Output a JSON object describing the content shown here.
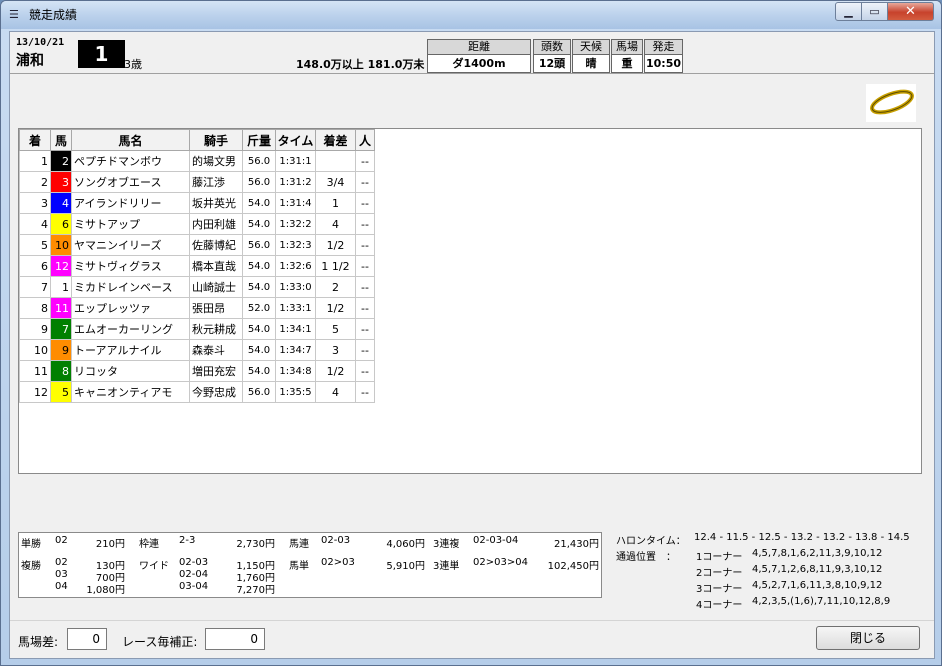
{
  "window": {
    "title": "競走成績",
    "icon": "list-icon"
  },
  "race": {
    "date": "13/10/21",
    "track": "浦和",
    "race_no": "1",
    "class": "3歳",
    "prize": "148.0万以上 181.0万未",
    "info_headers": [
      "距離",
      "頭数",
      "天候",
      "馬場",
      "発走"
    ],
    "info_values": [
      "ダ1400m",
      "12頭",
      "晴",
      "重",
      "10:50"
    ]
  },
  "colors": {
    "post_colors": [
      "#000000",
      "#ff0000",
      "#0000ff",
      "#ffff00",
      "#ff8c00",
      "#ff00ff",
      "#ffffff",
      "#ff00ff",
      "#008000",
      "#ff8c00",
      "#008000",
      "#ffff00"
    ],
    "post_text": [
      "#ffffff",
      "#ffffff",
      "#ffffff",
      "#000000",
      "#000000",
      "#ffffff",
      "#000000",
      "#ffffff",
      "#ffffff",
      "#000000",
      "#ffffff",
      "#000000"
    ]
  },
  "results": {
    "headers": [
      "着",
      "馬",
      "馬名",
      "騎手",
      "斤量",
      "タイム",
      "着差",
      "人"
    ],
    "rows": [
      {
        "pos": "1",
        "no": "2",
        "name": "ペプチドマンボウ",
        "jockey": "的場文男",
        "wt": "56.0",
        "time": "1:31:1",
        "margin": "",
        "pop": "--"
      },
      {
        "pos": "2",
        "no": "3",
        "name": "ソングオブエース",
        "jockey": "藤江渉",
        "wt": "56.0",
        "time": "1:31:2",
        "margin": "3/4",
        "pop": "--"
      },
      {
        "pos": "3",
        "no": "4",
        "name": "アイランドリリー",
        "jockey": "坂井英光",
        "wt": "54.0",
        "time": "1:31:4",
        "margin": "1",
        "pop": "--"
      },
      {
        "pos": "4",
        "no": "6",
        "name": "ミサトアップ",
        "jockey": "内田利雄",
        "wt": "54.0",
        "time": "1:32:2",
        "margin": "4",
        "pop": "--"
      },
      {
        "pos": "5",
        "no": "10",
        "name": "ヤマニンイリーズ",
        "jockey": "佐藤博紀",
        "wt": "56.0",
        "time": "1:32:3",
        "margin": "1/2",
        "pop": "--"
      },
      {
        "pos": "6",
        "no": "12",
        "name": "ミサトヴィグラス",
        "jockey": "橋本直哉",
        "wt": "54.0",
        "time": "1:32:6",
        "margin": "1 1/2",
        "pop": "--"
      },
      {
        "pos": "7",
        "no": "1",
        "name": "ミカドレインベース",
        "jockey": "山崎誠士",
        "wt": "54.0",
        "time": "1:33:0",
        "margin": "2",
        "pop": "--"
      },
      {
        "pos": "8",
        "no": "11",
        "name": "エップレッツァ",
        "jockey": "張田昂",
        "wt": "52.0",
        "time": "1:33:1",
        "margin": "1/2",
        "pop": "--"
      },
      {
        "pos": "9",
        "no": "7",
        "name": "エムオーカーリング",
        "jockey": "秋元耕成",
        "wt": "54.0",
        "time": "1:34:1",
        "margin": "5",
        "pop": "--"
      },
      {
        "pos": "10",
        "no": "9",
        "name": "トーアアルナイル",
        "jockey": "森泰斗",
        "wt": "54.0",
        "time": "1:34:7",
        "margin": "3",
        "pop": "--"
      },
      {
        "pos": "11",
        "no": "8",
        "name": "リコッタ",
        "jockey": "増田充宏",
        "wt": "54.0",
        "time": "1:34:8",
        "margin": "1/2",
        "pop": "--"
      },
      {
        "pos": "12",
        "no": "5",
        "name": "キャニオンティアモ",
        "jockey": "今野忠成",
        "wt": "56.0",
        "time": "1:35:5",
        "margin": "4",
        "pop": "--"
      }
    ]
  },
  "payouts": {
    "win": {
      "label": "単勝",
      "combo": "02",
      "amount": "210円"
    },
    "waku": {
      "label": "枠連",
      "combo": "2-3",
      "amount": "2,730円"
    },
    "umaren": {
      "label": "馬連",
      "combo": "02-03",
      "amount": "4,060円"
    },
    "sanrenpuku": {
      "label": "3連複",
      "combo": "02-03-04",
      "amount": "21,430円"
    },
    "place": {
      "label": "複勝",
      "combos": [
        "02",
        "03",
        "04"
      ],
      "amounts": [
        "130円",
        "700円",
        "1,080円"
      ]
    },
    "wide": {
      "label": "ワイド",
      "combos": [
        "02-03",
        "02-04",
        "03-04"
      ],
      "amounts": [
        "1,150円",
        "1,760円",
        "7,270円"
      ]
    },
    "umatan": {
      "label": "馬単",
      "combo": "02>03",
      "amount": "5,910円"
    },
    "sanrentan": {
      "label": "3連単",
      "combo": "02>03>04",
      "amount": "102,450円"
    }
  },
  "furlong": {
    "label": "ハロンタイム：",
    "times": "12.4 - 11.5 - 12.5 - 13.2 - 13.2 - 13.8 - 14.5",
    "pass_label": "通過位置　：",
    "corners": [
      {
        "name": "1コーナー",
        "order": "4,5,7,8,1,6,2,11,3,9,10,12"
      },
      {
        "name": "2コーナー",
        "order": "4,5,7,1,2,6,8,11,9,3,10,12"
      },
      {
        "name": "3コーナー",
        "order": "4,5,2,7,1,6,11,3,8,10,9,12"
      },
      {
        "name": "4コーナー",
        "order": "4,2,3,5,(1,6),7,11,10,12,8,9"
      }
    ]
  },
  "footer": {
    "track_diff_label": "馬場差:",
    "track_diff_value": "0",
    "race_adj_label": "レース毎補正:",
    "race_adj_value": "0",
    "close_label": "閉じる"
  }
}
